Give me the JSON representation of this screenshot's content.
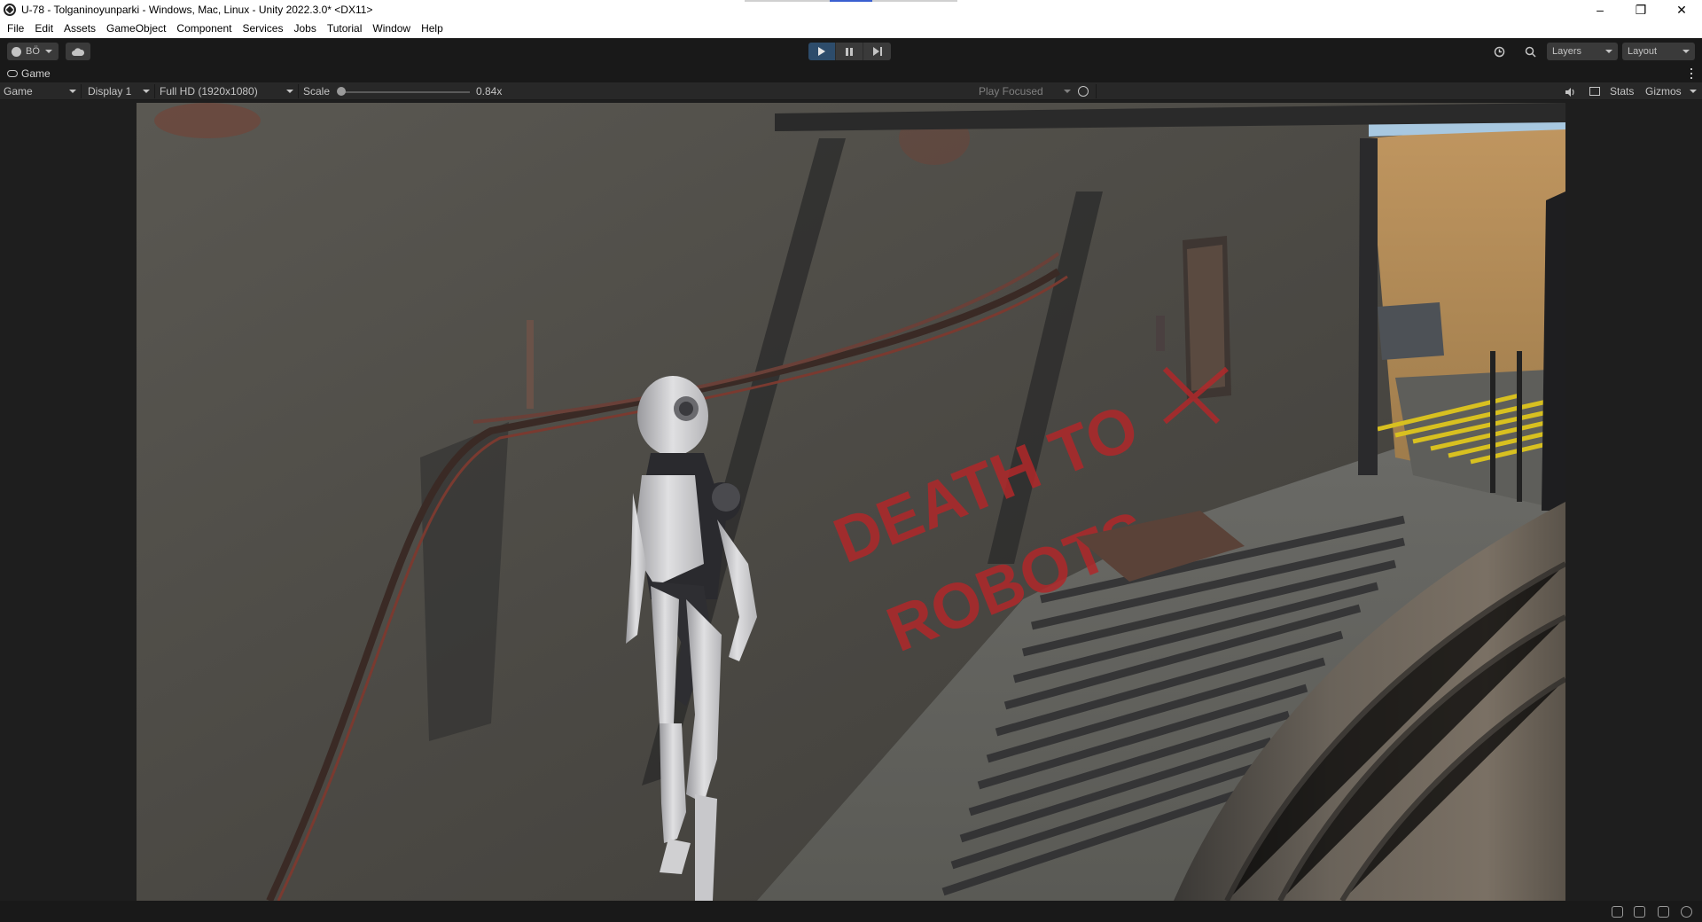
{
  "window": {
    "title": "U-78 - Tolganinoyunparki - Windows, Mac, Linux - Unity 2022.3.0* <DX11>",
    "minimize": "–",
    "restore": "❐",
    "close": "✕"
  },
  "menu": [
    "File",
    "Edit",
    "Assets",
    "GameObject",
    "Component",
    "Services",
    "Jobs",
    "Tutorial",
    "Window",
    "Help"
  ],
  "toolbar": {
    "account_label": "BÖ",
    "layers_label": "Layers",
    "layout_label": "Layout",
    "play_state": "playing"
  },
  "tab": {
    "game_label": "Game"
  },
  "gamebar": {
    "view_mode": "Game",
    "display": "Display 1",
    "resolution": "Full HD (1920x1080)",
    "scale_label": "Scale",
    "scale_value": "0.84x",
    "play_focused": "Play Focused",
    "stats": "Stats",
    "gizmos": "Gizmos"
  },
  "scene": {
    "graffiti_line1": "DEATH TO",
    "graffiti_line2": "ROBOTS"
  },
  "colors": {
    "editor_bg": "#191919",
    "play_active": "#2d4c6b",
    "graffiti": "#b0282a",
    "hazard_stripe": "#d8c020"
  },
  "icons": [
    "unity-logo-icon",
    "account-icon",
    "cloud-icon",
    "play-icon",
    "pause-icon",
    "step-icon",
    "history-icon",
    "search-icon",
    "gamepad-icon",
    "bug-icon",
    "speaker-icon",
    "grid-icon"
  ]
}
